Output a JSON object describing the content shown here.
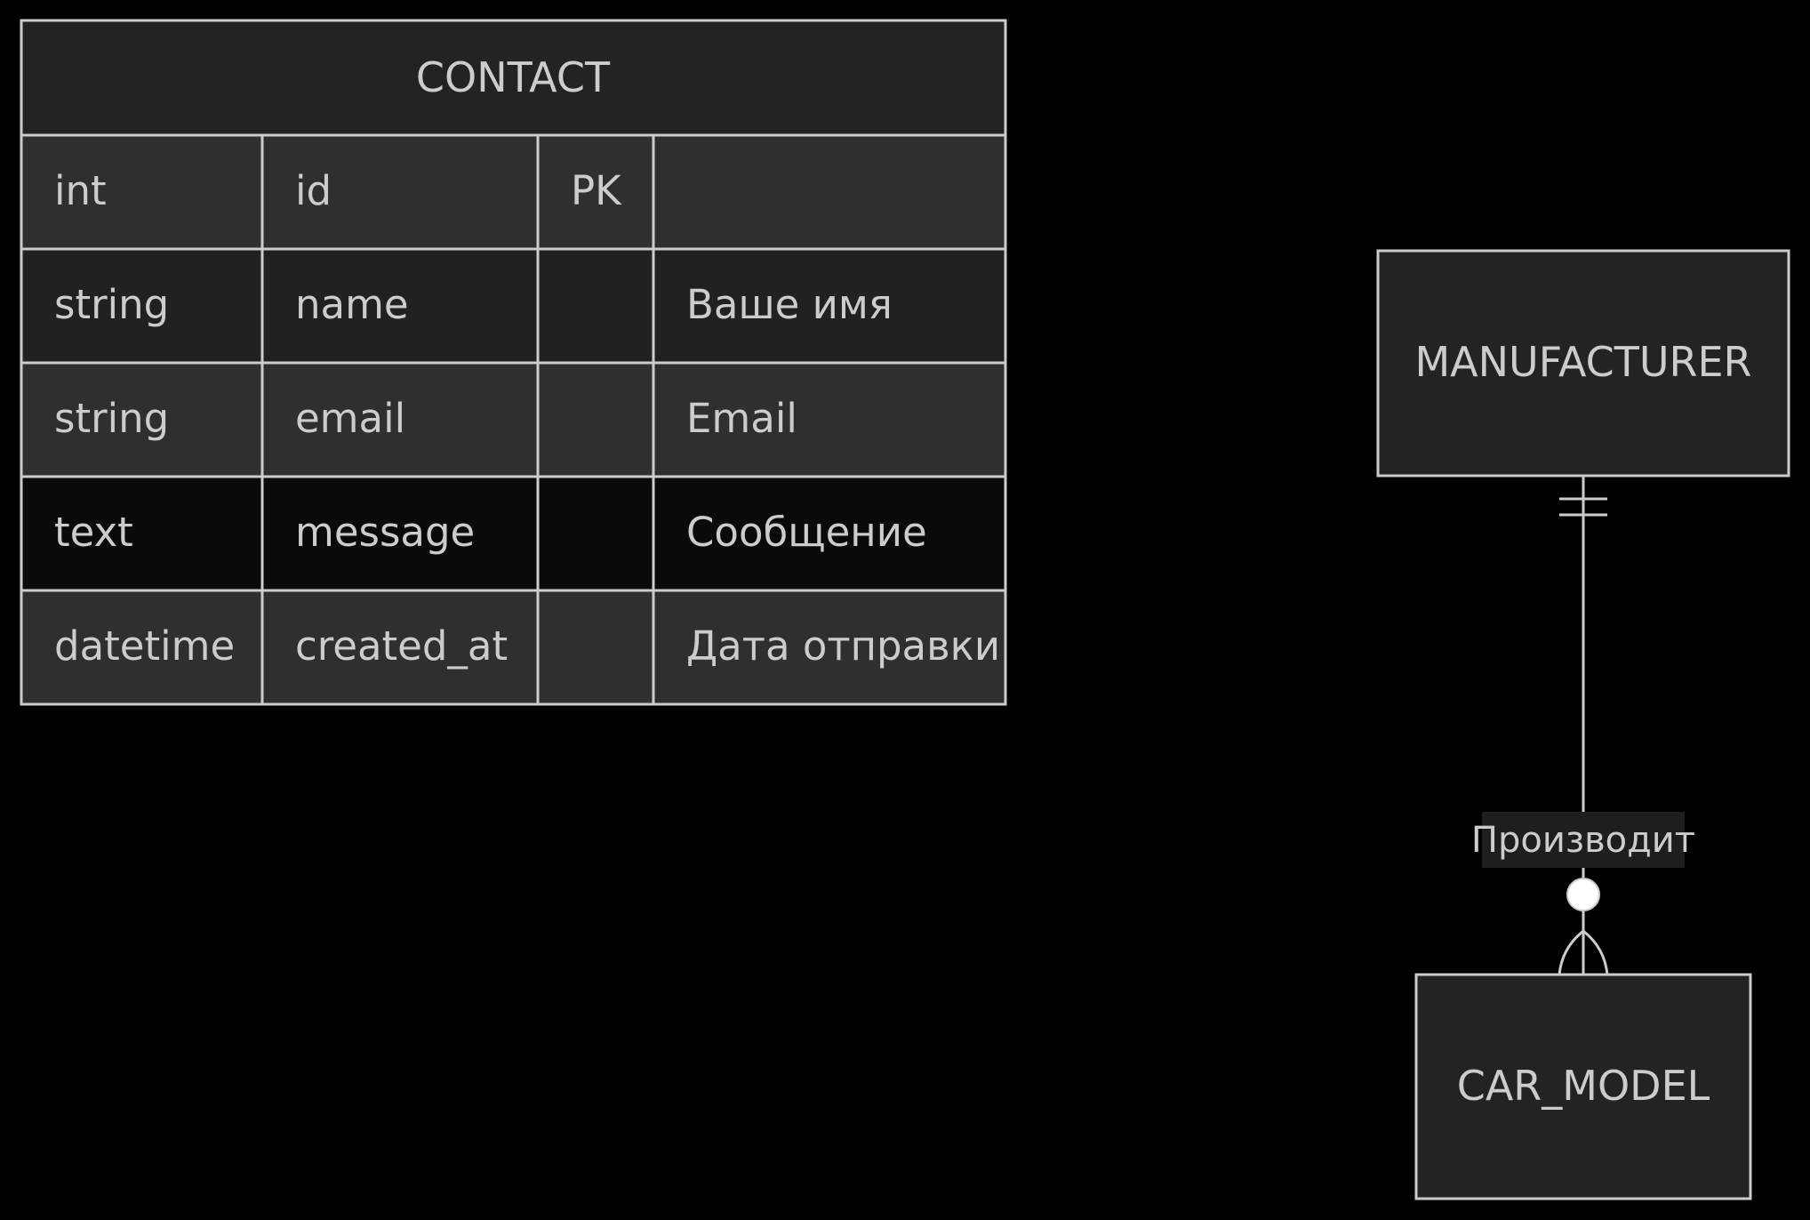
{
  "contact": {
    "title": "CONTACT",
    "attributes": [
      {
        "type": "int",
        "name": "id",
        "key": "PK",
        "comment": ""
      },
      {
        "type": "string",
        "name": "name",
        "key": "",
        "comment": "Ваше имя"
      },
      {
        "type": "string",
        "name": "email",
        "key": "",
        "comment": "Email"
      },
      {
        "type": "text",
        "name": "message",
        "key": "",
        "comment": "Сообщение"
      },
      {
        "type": "datetime",
        "name": "created_at",
        "key": "",
        "comment": "Дата отправки"
      }
    ]
  },
  "manufacturer": {
    "title": "MANUFACTURER"
  },
  "car_model": {
    "title": "CAR_MODEL"
  },
  "relationship": {
    "label": "Производит",
    "from_cardinality": "exactly-one",
    "to_cardinality": "zero-or-more"
  },
  "colors": {
    "background": "#000000",
    "stroke": "#cccccc",
    "text": "#cccccc",
    "title_fill": "#222323",
    "row_odd_fill": "#2e2f2f",
    "row_even_fill": "#202121",
    "row_dark_fill": "#0a0a0a",
    "label_bg": "#1e1e1e"
  }
}
